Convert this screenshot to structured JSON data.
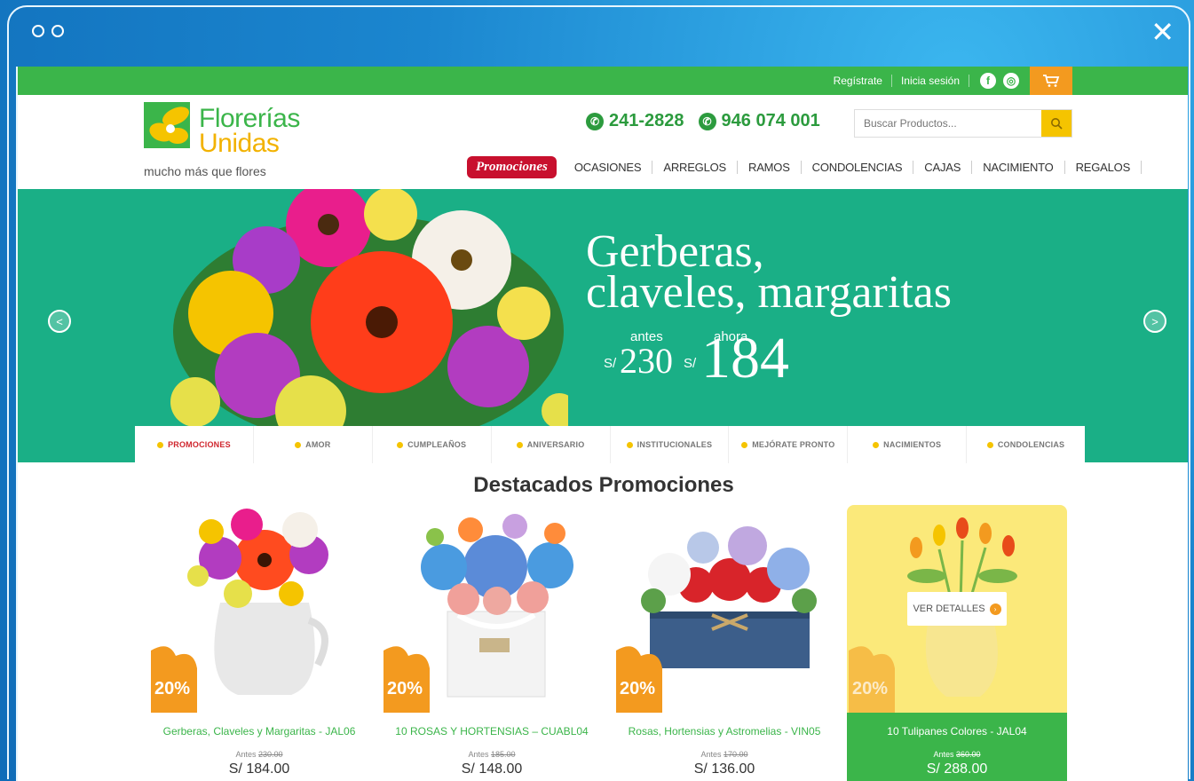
{
  "topbar": {
    "register_label": "Regístrate",
    "login_label": "Inicia sesión",
    "facebook_icon": "facebook-icon",
    "instagram_icon": "instagram-icon",
    "cart_icon": "cart-icon"
  },
  "header": {
    "logo_line1": "Florerías",
    "logo_line2": "Unidas",
    "tagline": "mucho más que flores",
    "phone1": "241-2828",
    "phone2": "946 074 001",
    "search_placeholder": "Buscar Productos..."
  },
  "mainnav": {
    "promo_label": "Promociones",
    "items": [
      "OCASIONES",
      "ARREGLOS",
      "RAMOS",
      "CONDOLENCIAS",
      "CAJAS",
      "NACIMIENTO",
      "REGALOS"
    ]
  },
  "hero": {
    "title_line1": "Gerberas,",
    "title_line2": "claveles, margaritas",
    "antes_label": "antes",
    "ahora_label": "ahora",
    "currency": "S/",
    "old_price": "230",
    "new_price": "184"
  },
  "category_tabs": [
    "PROMOCIONES",
    "AMOR",
    "CUMPLEAÑOS",
    "ANIVERSARIO",
    "INSTITUCIONALES",
    "MEJÓRATE PRONTO",
    "NACIMIENTOS",
    "CONDOLENCIAS"
  ],
  "active_tab": "PROMOCIONES",
  "section_title": "Destacados Promociones",
  "products": [
    {
      "name": "Gerberas, Claveles y Margaritas - JAL06",
      "discount": "20%",
      "antes_label": "Antes",
      "old_price": "230.00",
      "price": "S/ 184.00"
    },
    {
      "name": "10 ROSAS Y HORTENSIAS – CUABL04",
      "discount": "20%",
      "antes_label": "Antes",
      "old_price": "185.00",
      "price": "S/ 148.00"
    },
    {
      "name": "Rosas, Hortensias y Astromelias - VIN05",
      "discount": "20%",
      "antes_label": "Antes",
      "old_price": "170.00",
      "price": "S/ 136.00"
    },
    {
      "name": "10 Tulipanes Colores - JAL04",
      "discount": "20%",
      "antes_label": "Antes",
      "old_price": "360.00",
      "price": "S/ 288.00",
      "button": "VER DETALLES"
    }
  ],
  "colors": {
    "brand_green": "#3bb54a",
    "hero_teal": "#1aaf86",
    "accent_orange": "#f39a1f",
    "accent_yellow": "#f5c400",
    "promo_red": "#c8102e"
  }
}
